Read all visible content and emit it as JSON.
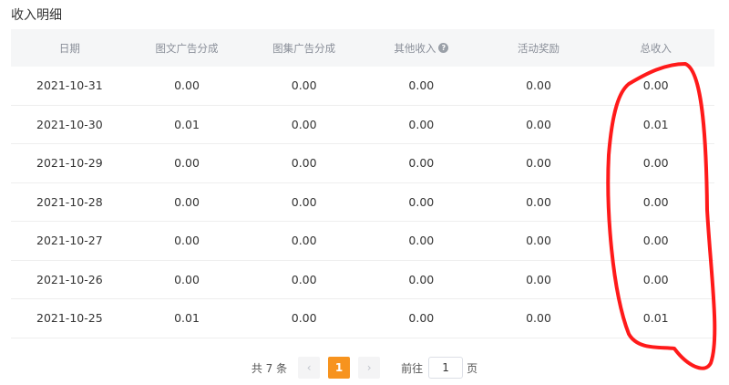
{
  "title": "收入明细",
  "table": {
    "headers": [
      "日期",
      "图文广告分成",
      "图集广告分成",
      "其他收入",
      "活动奖励",
      "总收入"
    ],
    "help_icon_glyph": "?",
    "rows": [
      [
        "2021-10-31",
        "0.00",
        "0.00",
        "0.00",
        "0.00",
        "0.00"
      ],
      [
        "2021-10-30",
        "0.01",
        "0.00",
        "0.00",
        "0.00",
        "0.01"
      ],
      [
        "2021-10-29",
        "0.00",
        "0.00",
        "0.00",
        "0.00",
        "0.00"
      ],
      [
        "2021-10-28",
        "0.00",
        "0.00",
        "0.00",
        "0.00",
        "0.00"
      ],
      [
        "2021-10-27",
        "0.00",
        "0.00",
        "0.00",
        "0.00",
        "0.00"
      ],
      [
        "2021-10-26",
        "0.00",
        "0.00",
        "0.00",
        "0.00",
        "0.00"
      ],
      [
        "2021-10-25",
        "0.01",
        "0.00",
        "0.00",
        "0.00",
        "0.01"
      ]
    ]
  },
  "pagination": {
    "total_text": "共 7 条",
    "prev_icon": "‹",
    "current_page": "1",
    "next_icon": "›",
    "goto_prefix": "前往",
    "goto_value": "1",
    "goto_suffix": "页"
  },
  "colors": {
    "accent": "#f7931e",
    "header_bg": "#f5f6f7",
    "annotation": "#ff1a1a"
  }
}
